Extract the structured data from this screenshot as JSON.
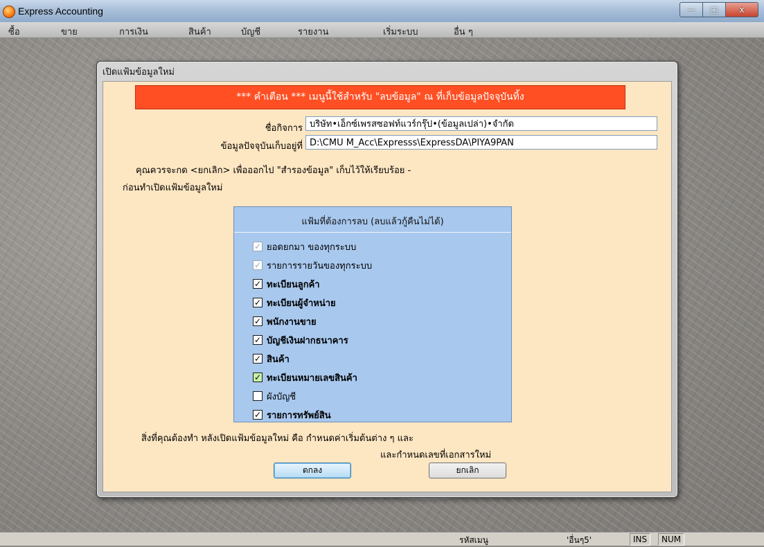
{
  "window": {
    "title": "Express Accounting",
    "minimize": "—",
    "maximize": "□",
    "close": "x"
  },
  "menu": [
    "ซื้อ",
    "ขาย",
    "การเงิน",
    "สินค้า",
    "บัญชี",
    "รายงาน",
    "เริ่มระบบ",
    "อื่น ๆ"
  ],
  "dialog": {
    "title": "เปิดแฟ้มข้อมูลใหม่",
    "warning": "*** คำเตือน ***  เมนูนี้ใช้สำหรับ \"ลบข้อมูล\" ณ ที่เก็บข้อมูลปัจจุบันทิ้ง",
    "company_label": "ชื่อกิจการ",
    "company_value": "บริษัท•เอ็กซ์เพรสซอฟท์แวร์กรุ๊ป•(ข้อมูลเปล่า)•จำกัด",
    "location_label": "ข้อมูลปัจจุบันเก็บอยู่ที่",
    "location_value": "D:\\CMU M_Acc\\Expresss\\ExpressDA\\PIYA9PAN",
    "advice_line1": "คุณควรจะกด <ยกเลิก> เพื่อออกไป \"สำรองข้อมูล\" เก็บไว้ให้เรียบร้อย -",
    "advice_line2": "ก่อนทำเปิดแฟ้มข้อมูลใหม่",
    "panel_title": "แฟ้มที่ต้องการลบ (ลบแล้วกู้คืนไม่ได้)",
    "items": [
      {
        "label": "ยอดยกมา ของทุกระบบ",
        "checked": true,
        "disabled": true,
        "mark": "✓"
      },
      {
        "label": "รายการรายวันของทุกระบบ",
        "checked": true,
        "disabled": true,
        "mark": "✓"
      },
      {
        "label": "ทะเบียนลูกค้า",
        "checked": true,
        "disabled": false,
        "mark": "✓"
      },
      {
        "label": "ทะเบียนผู้จำหน่าย",
        "checked": true,
        "disabled": false,
        "mark": "✓"
      },
      {
        "label": "พนักงานขาย",
        "checked": true,
        "disabled": false,
        "mark": "✓"
      },
      {
        "label": "บัญชีเงินฝากธนาคาร",
        "checked": true,
        "disabled": false,
        "mark": "✓"
      },
      {
        "label": "สินค้า",
        "checked": true,
        "disabled": false,
        "mark": "✓"
      },
      {
        "label": "ทะเบียนหมายเลขสินค้า",
        "checked": true,
        "disabled": false,
        "mark": "✓"
      },
      {
        "label": "ผังบัญชี",
        "checked": false,
        "disabled": false,
        "mark": ""
      },
      {
        "label": "รายการทรัพย์สิน",
        "checked": true,
        "disabled": false,
        "mark": "✓"
      }
    ],
    "after_line1": "สิ่งที่คุณต้องทำ หลังเปิดแฟ้มข้อมูลใหม่ คือ กำหนดค่าเริ่มต้นต่าง ๆ  และ",
    "after_line2": "และกำหนดเลขที่เอกสารใหม่",
    "ok_label": "ตกลง",
    "cancel_label": "ยกเลิก"
  },
  "status": {
    "label": "รหัสเมนู",
    "menu_code": "'อื่นๆ5'",
    "ins": "INS",
    "num": "NUM"
  },
  "colors": {
    "warning_bg": "#ff4f23",
    "panel_bg": "#a8c8ee",
    "body_bg": "#fde6c2"
  }
}
